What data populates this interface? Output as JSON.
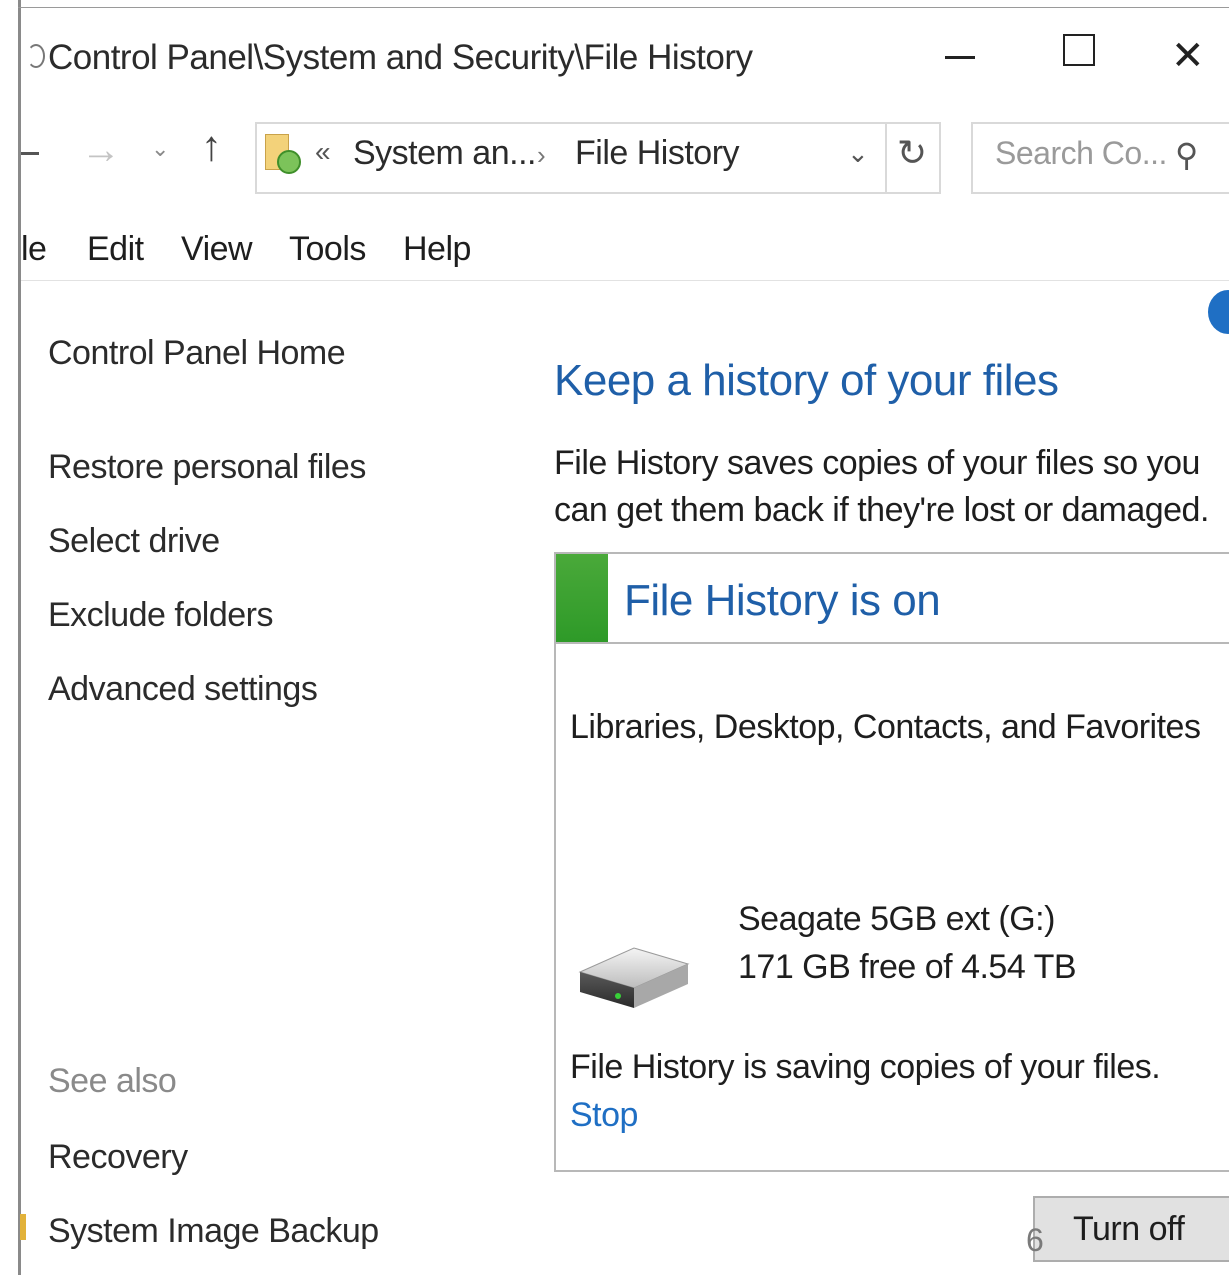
{
  "window": {
    "title": "Control Panel\\System and Security\\File History",
    "minimize_symbol": "—",
    "close_symbol": "✕"
  },
  "address_bar": {
    "overflow": "«",
    "crumbs": [
      "System an...",
      "File History"
    ],
    "separator": "›",
    "search_placeholder": "Search Co..."
  },
  "menu": [
    "le",
    "Edit",
    "View",
    "Tools",
    "Help"
  ],
  "left_pane": {
    "home": "Control Panel Home",
    "links": [
      "Restore personal files",
      "Select drive",
      "Exclude folders",
      "Advanced settings"
    ],
    "see_also_label": "See also",
    "see_also": [
      "Recovery",
      "System Image Backup"
    ]
  },
  "main": {
    "title": "Keep a history of your files",
    "description": "File History saves copies of your files so you can get them back if they're lost or damaged.",
    "status": {
      "title": "File History is on",
      "indicator_color": "#2e9a28",
      "libraries": "Libraries, Desktop, Contacts, and Favorites",
      "drive_name": "Seagate 5GB ext (G:)",
      "drive_free": "171 GB free of 4.54 TB",
      "saving": "File History is saving copies of your files.",
      "stop": "Stop"
    },
    "turn_off": "Turn off",
    "page_number": "6"
  },
  "colors": {
    "heading_blue": "#1f5fa8",
    "link_blue": "#1f6fc4",
    "status_green": "#2e9a28"
  },
  "icons": [
    "window-icon",
    "minimize-icon",
    "maximize-icon",
    "close-icon",
    "forward-arrow-icon",
    "recent-locations-chevron-icon",
    "up-arrow-icon",
    "file-history-icon",
    "address-dropdown-icon",
    "refresh-icon",
    "search-icon",
    "help-icon",
    "drive-icon"
  ]
}
